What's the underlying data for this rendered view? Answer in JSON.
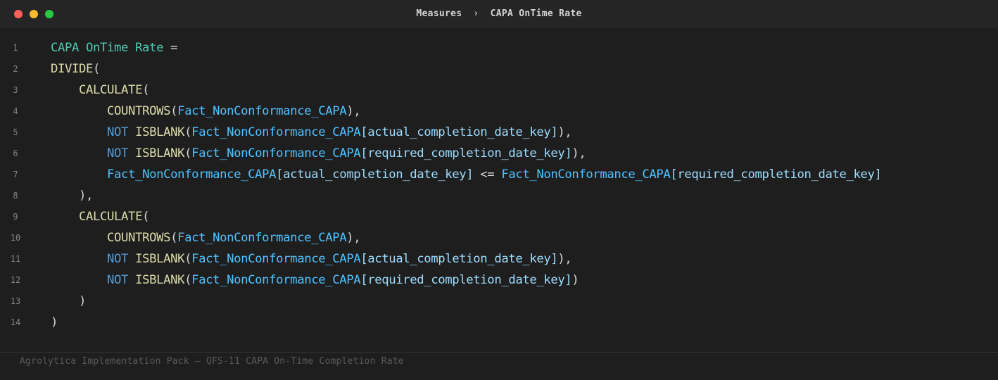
{
  "window": {
    "controls": [
      "close",
      "minimize",
      "maximize"
    ]
  },
  "breadcrumb": {
    "parent": "Measures",
    "separator": "›",
    "current": "CAPA OnTime Rate"
  },
  "editor": {
    "language": "DAX",
    "colors": {
      "measure": "#4ec9b0",
      "function": "#dcdcaa",
      "table": "#4fc1ff",
      "keyword": "#569cd6",
      "punctuation": "#d4d4d4"
    },
    "lines": [
      {
        "number": "1",
        "indent": 0,
        "tokens": [
          {
            "t": "CAPA OnTime Rate",
            "k": "measure"
          },
          {
            "t": " =",
            "k": "op"
          }
        ]
      },
      {
        "number": "2",
        "indent": 0,
        "tokens": [
          {
            "t": "DIVIDE",
            "k": "fn"
          },
          {
            "t": "(",
            "k": "punc"
          }
        ]
      },
      {
        "number": "3",
        "indent": 1,
        "tokens": [
          {
            "t": "CALCULATE",
            "k": "fn"
          },
          {
            "t": "(",
            "k": "punc"
          }
        ]
      },
      {
        "number": "4",
        "indent": 2,
        "tokens": [
          {
            "t": "COUNTROWS",
            "k": "fn"
          },
          {
            "t": "(",
            "k": "punc"
          },
          {
            "t": "Fact_NonConformance_CAPA",
            "k": "tbl"
          },
          {
            "t": "),",
            "k": "punc"
          }
        ]
      },
      {
        "number": "5",
        "indent": 2,
        "tokens": [
          {
            "t": "NOT",
            "k": "kw"
          },
          {
            "t": " ",
            "k": "punc"
          },
          {
            "t": "ISBLANK",
            "k": "fn"
          },
          {
            "t": "(",
            "k": "punc"
          },
          {
            "t": "Fact_NonConformance_CAPA",
            "k": "tbl"
          },
          {
            "t": "[actual_completion_date_key]",
            "k": "col"
          },
          {
            "t": "),",
            "k": "punc"
          }
        ]
      },
      {
        "number": "6",
        "indent": 2,
        "tokens": [
          {
            "t": "NOT",
            "k": "kw"
          },
          {
            "t": " ",
            "k": "punc"
          },
          {
            "t": "ISBLANK",
            "k": "fn"
          },
          {
            "t": "(",
            "k": "punc"
          },
          {
            "t": "Fact_NonConformance_CAPA",
            "k": "tbl"
          },
          {
            "t": "[required_completion_date_key]",
            "k": "col"
          },
          {
            "t": "),",
            "k": "punc"
          }
        ]
      },
      {
        "number": "7",
        "indent": 2,
        "tokens": [
          {
            "t": "Fact_NonConformance_CAPA",
            "k": "tbl"
          },
          {
            "t": "[actual_completion_date_key]",
            "k": "col"
          },
          {
            "t": " <= ",
            "k": "op"
          },
          {
            "t": "Fact_NonConformance_CAPA",
            "k": "tbl"
          },
          {
            "t": "[required_completion_date_key]",
            "k": "col"
          }
        ]
      },
      {
        "number": "8",
        "indent": 1,
        "tokens": [
          {
            "t": "),",
            "k": "punc"
          }
        ]
      },
      {
        "number": "9",
        "indent": 1,
        "tokens": [
          {
            "t": "CALCULATE",
            "k": "fn"
          },
          {
            "t": "(",
            "k": "punc"
          }
        ]
      },
      {
        "number": "10",
        "indent": 2,
        "tokens": [
          {
            "t": "COUNTROWS",
            "k": "fn"
          },
          {
            "t": "(",
            "k": "punc"
          },
          {
            "t": "Fact_NonConformance_CAPA",
            "k": "tbl"
          },
          {
            "t": "),",
            "k": "punc"
          }
        ]
      },
      {
        "number": "11",
        "indent": 2,
        "tokens": [
          {
            "t": "NOT",
            "k": "kw"
          },
          {
            "t": " ",
            "k": "punc"
          },
          {
            "t": "ISBLANK",
            "k": "fn"
          },
          {
            "t": "(",
            "k": "punc"
          },
          {
            "t": "Fact_NonConformance_CAPA",
            "k": "tbl"
          },
          {
            "t": "[actual_completion_date_key]",
            "k": "col"
          },
          {
            "t": "),",
            "k": "punc"
          }
        ]
      },
      {
        "number": "12",
        "indent": 2,
        "tokens": [
          {
            "t": "NOT",
            "k": "kw"
          },
          {
            "t": " ",
            "k": "punc"
          },
          {
            "t": "ISBLANK",
            "k": "fn"
          },
          {
            "t": "(",
            "k": "punc"
          },
          {
            "t": "Fact_NonConformance_CAPA",
            "k": "tbl"
          },
          {
            "t": "[required_completion_date_key]",
            "k": "col"
          },
          {
            "t": ")",
            "k": "punc"
          }
        ]
      },
      {
        "number": "13",
        "indent": 1,
        "tokens": [
          {
            "t": ")",
            "k": "punc"
          }
        ]
      },
      {
        "number": "14",
        "indent": 0,
        "tokens": [
          {
            "t": ")",
            "k": "punc"
          }
        ]
      }
    ]
  },
  "footer": {
    "caption": "Agrolytica Implementation Pack — QFS-11 CAPA On-Time Completion Rate"
  }
}
